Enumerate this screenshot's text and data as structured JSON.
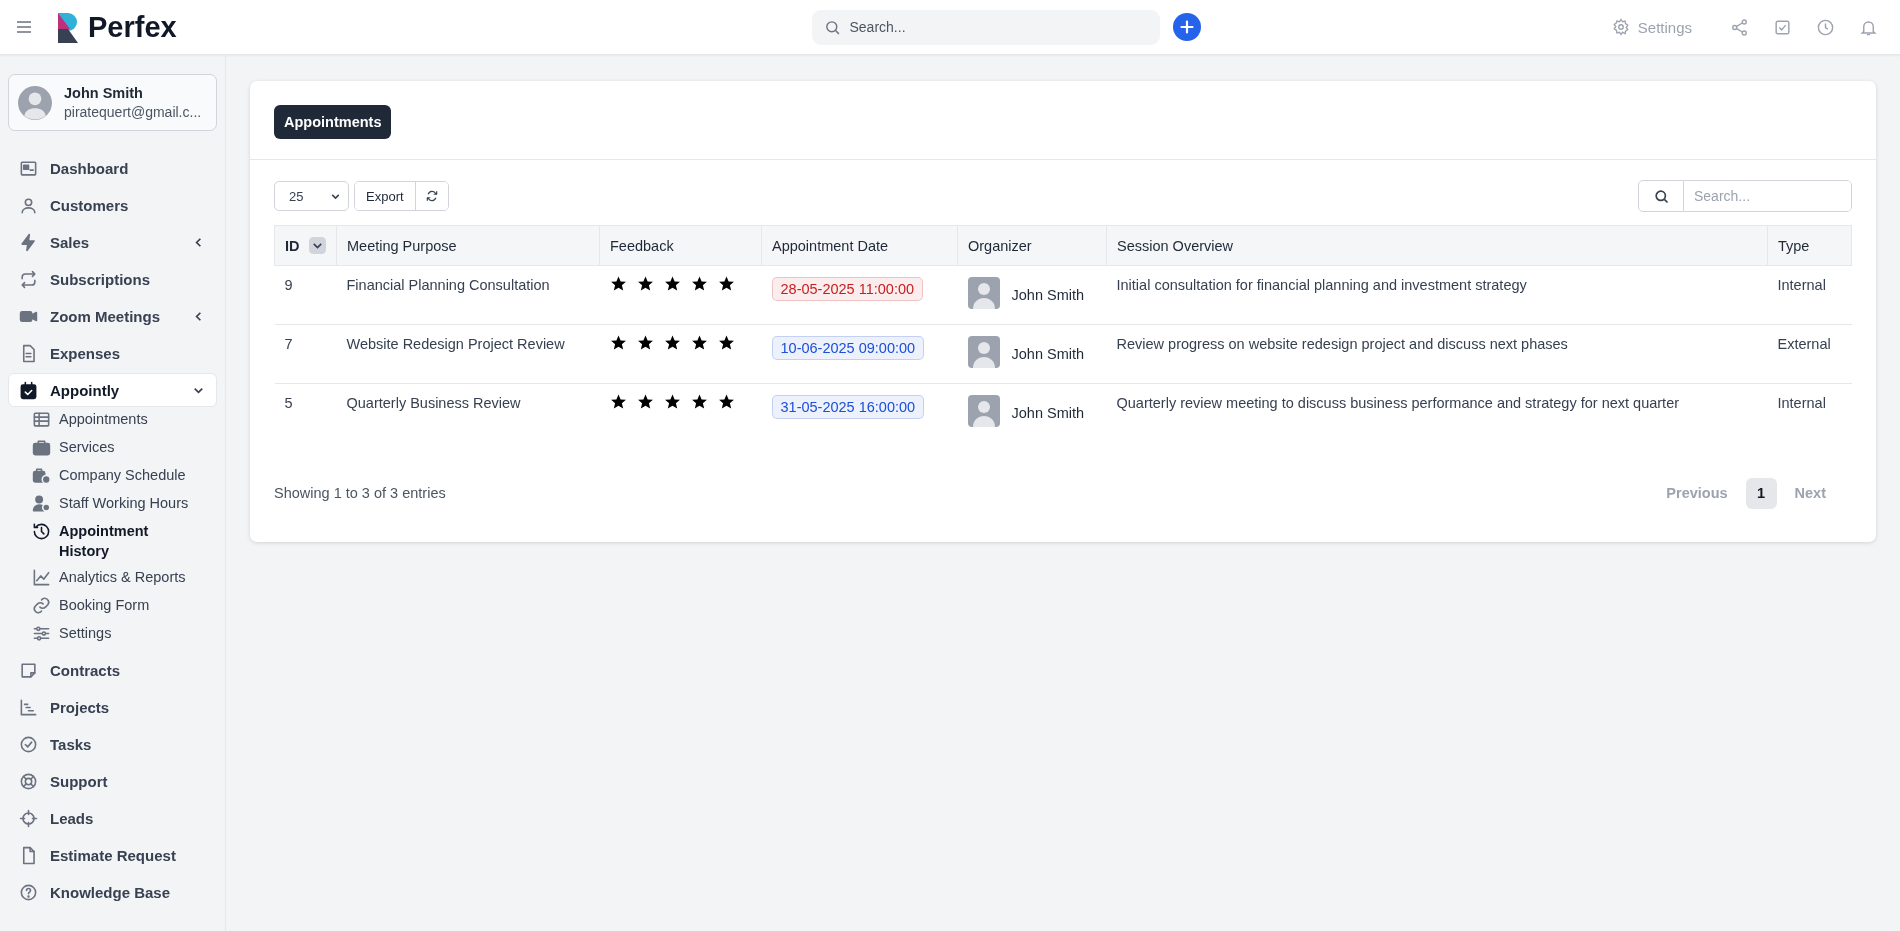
{
  "topbar": {
    "logo": "Perfex",
    "search": {
      "placeholder": "Search..."
    },
    "settings": "Settings"
  },
  "user": {
    "name": "John Smith",
    "email": "piratequert@gmail.c..."
  },
  "sidebar": {
    "items": [
      {
        "label": "Dashboard",
        "selected": false
      },
      {
        "label": "Customers",
        "selected": false
      },
      {
        "label": "Sales",
        "selected": false,
        "expanded": false
      },
      {
        "label": "Subscriptions",
        "selected": false
      },
      {
        "label": "Zoom Meetings",
        "selected": false,
        "expanded": false
      },
      {
        "label": "Expenses",
        "selected": false
      },
      {
        "label": "Appointly",
        "selected": true,
        "expanded": true,
        "children": [
          {
            "label": "Appointments",
            "selected": false
          },
          {
            "label": "Services",
            "selected": false
          },
          {
            "label": "Company Schedule",
            "selected": false
          },
          {
            "label": "Staff Working Hours",
            "selected": false
          },
          {
            "label": "Appointment History",
            "selected": true
          },
          {
            "label": "Analytics & Reports",
            "selected": false
          },
          {
            "label": "Booking Form",
            "selected": false
          },
          {
            "label": "Settings",
            "selected": false
          }
        ]
      },
      {
        "label": "Contracts",
        "selected": false
      },
      {
        "label": "Projects",
        "selected": false
      },
      {
        "label": "Tasks",
        "selected": false
      },
      {
        "label": "Support",
        "selected": false
      },
      {
        "label": "Leads",
        "selected": false
      },
      {
        "label": "Estimate Request",
        "selected": false
      },
      {
        "label": "Knowledge Base",
        "selected": false
      }
    ]
  },
  "card": {
    "title": "Appointments",
    "page_length": "25",
    "export": "Export",
    "search": {
      "placeholder": "Search..."
    },
    "table": {
      "columns": [
        "ID",
        "Meeting Purpose",
        "Feedback",
        "Appointment Date",
        "Organizer",
        "Session Overview",
        "Type"
      ],
      "rows": [
        {
          "id": "9",
          "purpose": "Financial Planning Consultation",
          "stars": 5,
          "date": "28-05-2025 11:00:00",
          "color": "#c81e1e",
          "organizer": "John Smith",
          "overview": "Initial consultation for financial planning and investment strategy",
          "type": "Internal"
        },
        {
          "id": "7",
          "purpose": "Website Redesign Project Review",
          "stars": 5,
          "date": "10-06-2025 09:00:00",
          "color": "#1c4fd8",
          "organizer": "John Smith",
          "overview": "Review progress on website redesign project and discuss next phases",
          "type": "External"
        },
        {
          "id": "5",
          "purpose": "Quarterly Business Review",
          "stars": 5,
          "date": "31-05-2025 16:00:00",
          "color": "#1c4fd8",
          "organizer": "John Smith",
          "overview": "Quarterly review meeting to discuss business performance and strategy for next quarter",
          "type": "Internal"
        }
      ]
    },
    "info": "Showing 1 to 3 of 3 entries",
    "pagination": {
      "previous": "Previous",
      "pages": [
        {
          "label": "1",
          "selected": true
        }
      ],
      "next": "Next"
    }
  }
}
